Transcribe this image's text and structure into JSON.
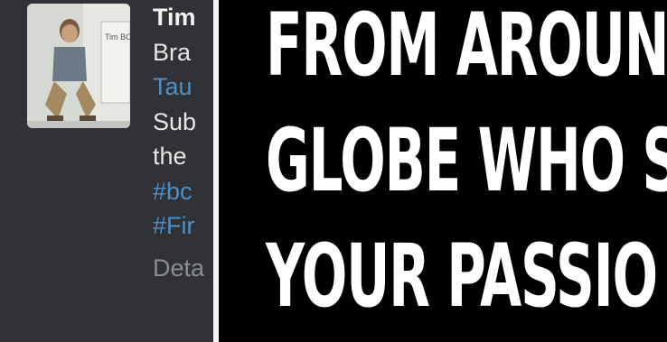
{
  "profile": {
    "name_fragment": "Tim",
    "bio_lines": [
      "Bra",
      "Tau",
      "Sub",
      "the"
    ],
    "link_lines": [
      "#bc",
      "#Fir"
    ],
    "details_fragment": "Deta",
    "avatar_sign_text": "Tim BOY"
  },
  "banner": {
    "lines": [
      "FROM AROUN",
      "GLOBE WHO S",
      "YOUR PASSIO"
    ]
  }
}
